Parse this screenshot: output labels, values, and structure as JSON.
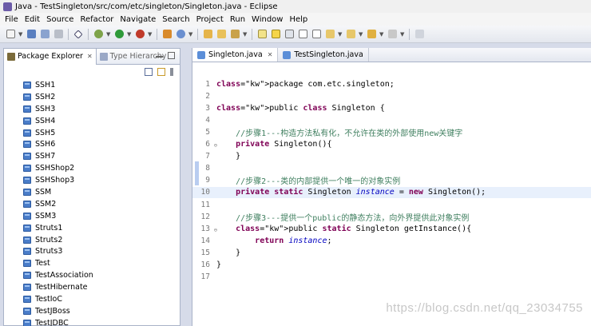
{
  "window": {
    "title": "Java - TestSingleton/src/com/etc/singleton/Singleton.java - Eclipse"
  },
  "menu": [
    "File",
    "Edit",
    "Source",
    "Refactor",
    "Navigate",
    "Search",
    "Project",
    "Run",
    "Window",
    "Help"
  ],
  "left_panel": {
    "tabs": [
      {
        "label": "Package Explorer",
        "active": true
      },
      {
        "label": "Type Hierarchy",
        "active": false
      }
    ],
    "projects": [
      "SSH1",
      "SSH2",
      "SSH3",
      "SSH4",
      "SSH5",
      "SSH6",
      "SSH7",
      "SSHShop2",
      "SSHShop3",
      "SSM",
      "SSM2",
      "SSM3",
      "Struts1",
      "Struts2",
      "Struts3",
      "Test",
      "TestAssociation",
      "TestHibernate",
      "TestIoC",
      "TestJBoss",
      "TestJDBC"
    ]
  },
  "editor": {
    "tabs": [
      {
        "label": "Singleton.java",
        "active": true
      },
      {
        "label": "TestSingleton.java",
        "active": false
      }
    ],
    "current_line": 10,
    "lines": [
      {
        "num": "1",
        "text": "package com.etc.singleton;"
      },
      {
        "num": "2",
        "text": ""
      },
      {
        "num": "3",
        "text": "public class Singleton {"
      },
      {
        "num": "4",
        "text": ""
      },
      {
        "num": "5",
        "text": "    //步骤1---构造方法私有化，不允许在类的外部使用new关键字"
      },
      {
        "num": "6",
        "text": "    private Singleton(){"
      },
      {
        "num": "7",
        "text": "    }"
      },
      {
        "num": "8",
        "text": ""
      },
      {
        "num": "9",
        "text": "    //步骤2---类的内部提供一个唯一的对象实例"
      },
      {
        "num": "10",
        "text": "    private static Singleton instance = new Singleton();"
      },
      {
        "num": "11",
        "text": ""
      },
      {
        "num": "12",
        "text": "    //步骤3---提供一个public的静态方法，向外界提供此对象实例"
      },
      {
        "num": "13",
        "text": "    public static Singleton getInstance(){"
      },
      {
        "num": "14",
        "text": "        return instance;"
      },
      {
        "num": "15",
        "text": "    }"
      },
      {
        "num": "16",
        "text": "}"
      },
      {
        "num": "17",
        "text": ""
      }
    ]
  },
  "watermark": "https://blog.csdn.net/qq_23034755",
  "colors": {
    "keyword": "#7f0055",
    "comment": "#3f7f5f",
    "field": "#0000c0",
    "current_line": "#e8f0fc"
  }
}
